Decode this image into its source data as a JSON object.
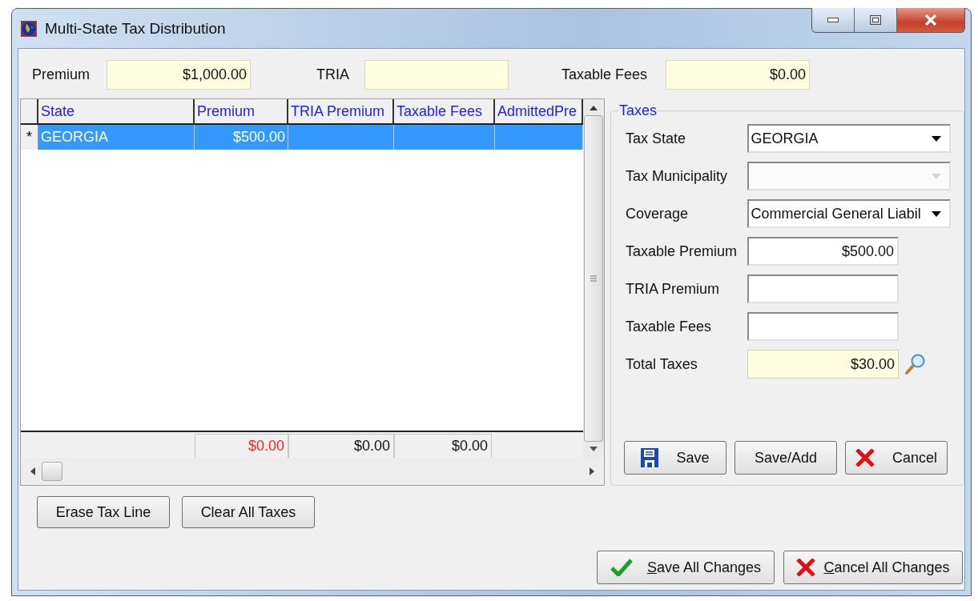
{
  "window": {
    "title": "Multi-State Tax Distribution"
  },
  "summary": [
    {
      "label": "Premium",
      "value": "$1,000.00"
    },
    {
      "label": "TRIA"
    },
    {
      "label": "Taxable Fees",
      "value": "$0.00"
    }
  ],
  "grid": {
    "columns": [
      "State",
      "Premium",
      "TRIA Premium",
      "Taxable Fees",
      "AdmittedPre"
    ],
    "rows": [
      {
        "marker": "*",
        "selected": true,
        "cells": [
          "GEORGIA",
          "$500.00"
        ]
      }
    ],
    "totals": [
      {
        "value": "$0.00",
        "alert": true
      },
      {
        "value": "$0.00",
        "alert": false
      },
      {
        "value": "$0.00",
        "alert": false
      }
    ]
  },
  "taxes": {
    "title": "Taxes",
    "fields": [
      {
        "kind": "combo",
        "label": "Tax State",
        "value": "GEORGIA",
        "disabled": false
      },
      {
        "kind": "combo",
        "label": "Tax Municipality",
        "disabled": true
      },
      {
        "kind": "combo",
        "label": "Coverage",
        "value": "Commercial General Liabil",
        "disabled": false
      },
      {
        "kind": "text",
        "label": "Taxable Premium",
        "value": "$500.00",
        "readonly": false
      },
      {
        "kind": "text",
        "label": "TRIA Premium",
        "readonly": false
      },
      {
        "kind": "text",
        "label": "Taxable Fees",
        "readonly": false
      },
      {
        "kind": "text",
        "label": "Total Taxes",
        "value": "$30.00",
        "readonly": true,
        "lookup": true
      }
    ],
    "buttons": [
      {
        "label": "Save",
        "kind": "save"
      },
      {
        "label": "Save/Add",
        "kind": "plain"
      },
      {
        "label": "Cancel",
        "kind": "cancel"
      }
    ]
  },
  "grid_buttons": [
    "Erase Tax Line",
    "Clear All Taxes"
  ],
  "footer_buttons": [
    {
      "label": "Save All Changes",
      "kind": "confirm",
      "mnemonic": true
    },
    {
      "label": "Cancel All Changes",
      "kind": "cancel",
      "mnemonic": true
    }
  ]
}
